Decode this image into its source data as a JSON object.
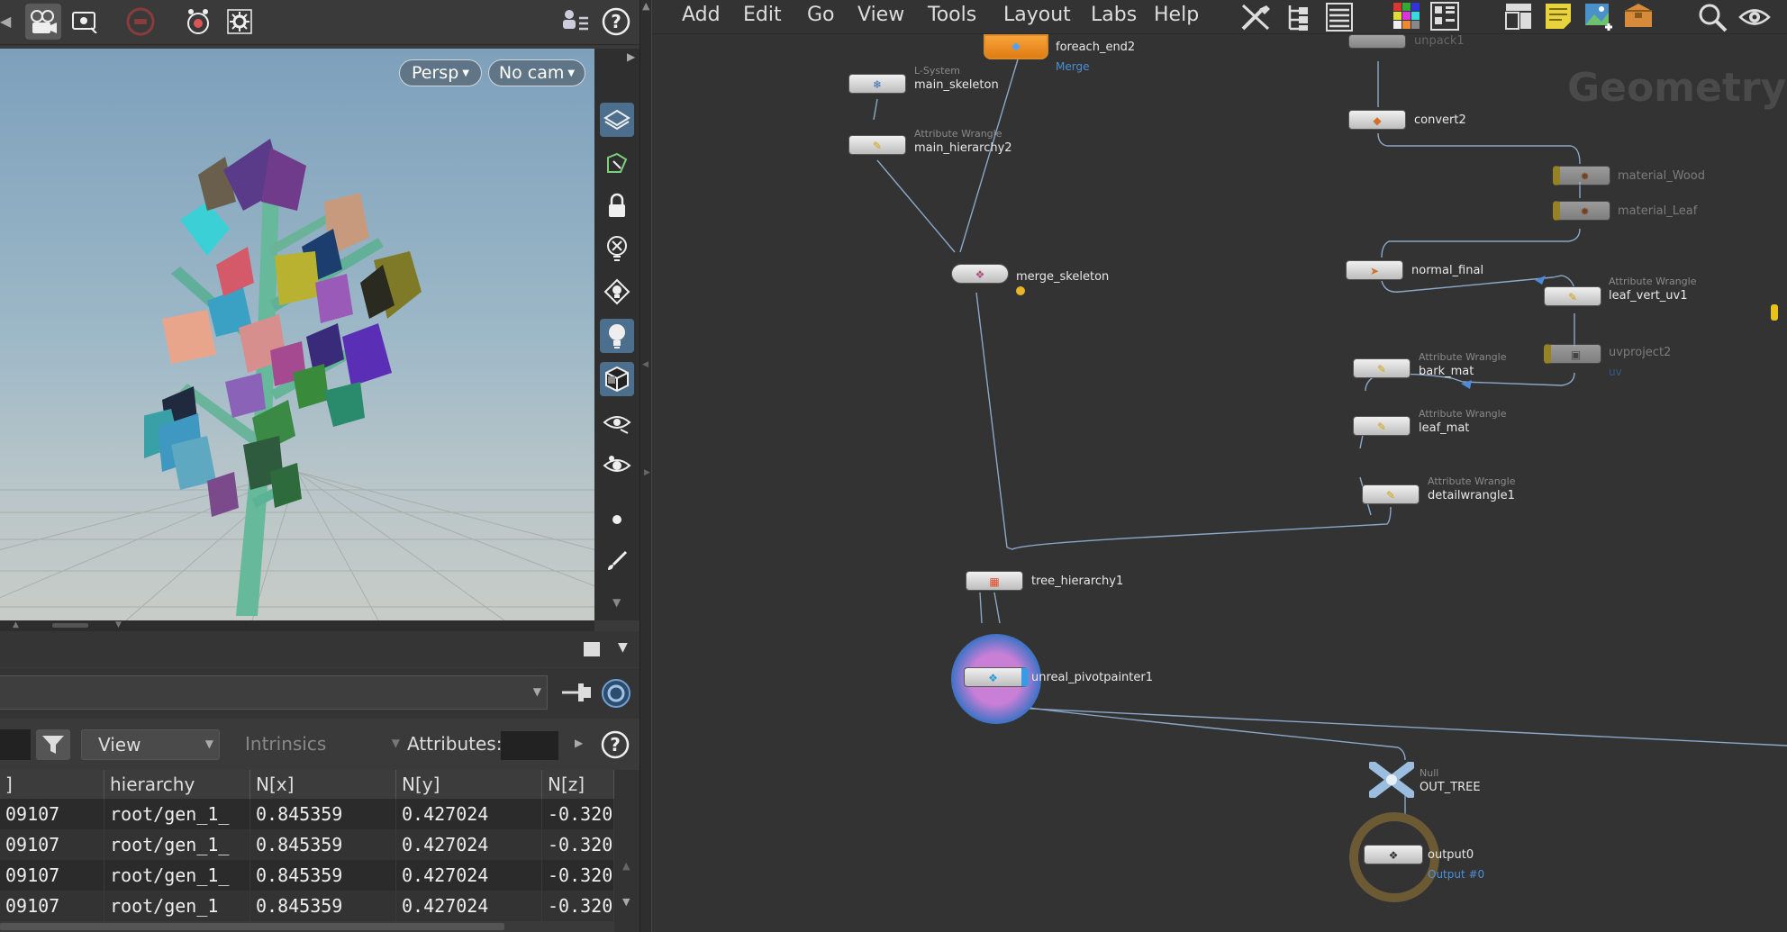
{
  "viewport": {
    "camera_view": "Persp",
    "camera": "No cam"
  },
  "spreadsheet": {
    "filter_view": "View",
    "intrinsics": "Intrinsics",
    "attributes_label": "Attributes:",
    "columns": [
      "]",
      "hierarchy",
      "N[x]",
      "N[y]",
      "N[z]"
    ],
    "rows": [
      [
        "09107",
        "root/gen_1_",
        "0.845359",
        "0.427024",
        "-0.320"
      ],
      [
        "09107",
        "root/gen_1_",
        "0.845359",
        "0.427024",
        "-0.320"
      ],
      [
        "09107",
        "root/gen_1_",
        "0.845359",
        "0.427024",
        "-0.320"
      ],
      [
        "09107",
        "root/gen_1",
        "0.845359",
        "0.427024",
        "-0.320"
      ]
    ]
  },
  "menu": [
    "Add",
    "Edit",
    "Go",
    "View",
    "Tools",
    "Layout",
    "Labs",
    "Help"
  ],
  "network": {
    "context_label": "Geometry",
    "nodes": {
      "foreach_end2": {
        "name": "foreach_end2",
        "sub": "Merge"
      },
      "main_skeleton": {
        "type": "L-System",
        "name": "main_skeleton"
      },
      "main_hierarchy2": {
        "type": "Attribute Wrangle",
        "name": "main_hierarchy2"
      },
      "merge_skeleton": {
        "name": "merge_skeleton"
      },
      "unpack1": {
        "name": "unpack1"
      },
      "convert2": {
        "name": "convert2"
      },
      "material_wood": {
        "name": "material_Wood"
      },
      "material_leaf": {
        "name": "material_Leaf"
      },
      "normal_final": {
        "name": "normal_final"
      },
      "leaf_vert_uv1": {
        "type": "Attribute Wrangle",
        "name": "leaf_vert_uv1"
      },
      "uvproject2": {
        "name": "uvproject2",
        "sub": "uv"
      },
      "bark_mat": {
        "type": "Attribute Wrangle",
        "name": "bark_mat"
      },
      "leaf_mat": {
        "type": "Attribute Wrangle",
        "name": "leaf_mat"
      },
      "detailwrangle1": {
        "type": "Attribute Wrangle",
        "name": "detailwrangle1"
      },
      "tree_hierarchy1": {
        "name": "tree_hierarchy1"
      },
      "unreal_pivotpainter1": {
        "name": "unreal_pivotpainter1"
      },
      "out_tree": {
        "type": "Null",
        "name": "OUT_TREE"
      },
      "output0": {
        "name": "output0",
        "sub": "Output #0"
      }
    }
  },
  "icons": {
    "camera": "camera-icon",
    "display": "display-icon",
    "stop": "stop-icon",
    "render": "render-icon",
    "settings": "gear-icon",
    "help": "help-icon",
    "search": "search-icon",
    "eye": "eye-icon",
    "wrench": "wrench-icon",
    "tree": "tree-icon",
    "list": "list-icon",
    "palette": "palette-icon",
    "grid": "grid-icon",
    "sticky": "sticky-note-icon",
    "image": "image-icon",
    "box": "box-icon",
    "filter": "filter-icon",
    "pin": "pin-icon"
  }
}
